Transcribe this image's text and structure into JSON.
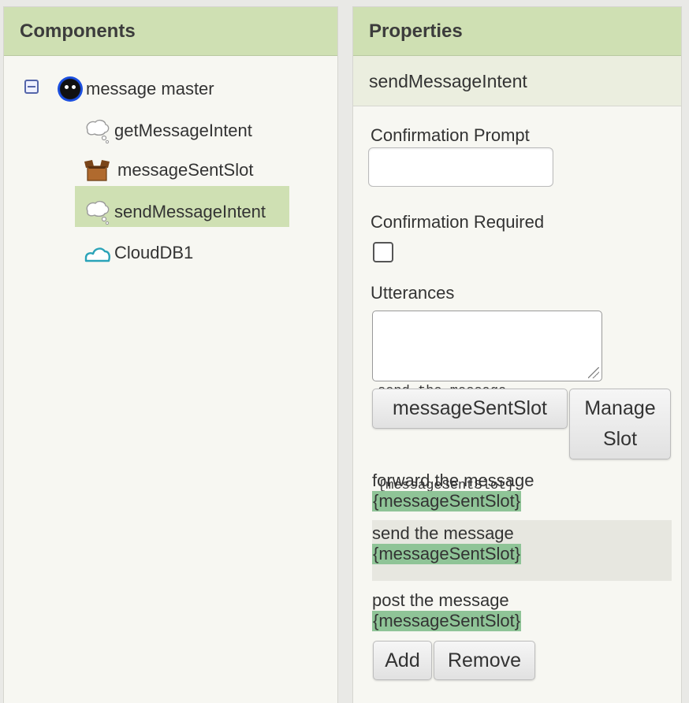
{
  "components": {
    "header": "Components",
    "tree": {
      "root": {
        "label": "message master",
        "icon": "app-face-icon"
      },
      "children": [
        {
          "label": "getMessageIntent",
          "icon": "thought-bubble-icon"
        },
        {
          "label": "messageSentSlot",
          "icon": "open-box-icon"
        },
        {
          "label": "sendMessageIntent",
          "icon": "thought-bubble-icon",
          "selected": true
        },
        {
          "label": "CloudDB1",
          "icon": "cloud-icon"
        }
      ]
    }
  },
  "properties": {
    "header": "Properties",
    "component_name": "sendMessageIntent",
    "confirmation_prompt": {
      "label": "Confirmation Prompt",
      "value": ""
    },
    "confirmation_required": {
      "label": "Confirmation Required",
      "checked": false
    },
    "utterances": {
      "label": "Utterances",
      "editor_lines": [
        "send the message",
        "{messageSentSlot}"
      ],
      "slot_button": "messageSentSlot",
      "manage_slot_button": "Manage Slot",
      "manage_slot_line1": "Manage",
      "manage_slot_line2": "Slot",
      "list": [
        {
          "text": "forward the message",
          "slot": "{messageSentSlot}"
        },
        {
          "text": "send the message",
          "slot": "{messageSentSlot}"
        },
        {
          "text": "post the message",
          "slot": "{messageSentSlot}"
        }
      ],
      "add_button": "Add",
      "remove_button": "Remove"
    }
  },
  "colors": {
    "header_bg": "#cfe0b3",
    "selected_bg": "#cfe0b3",
    "slot_highlight": "#8fc497"
  }
}
